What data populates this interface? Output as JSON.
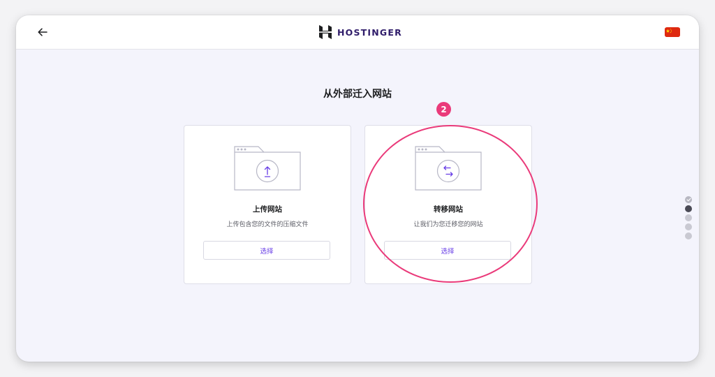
{
  "header": {
    "brand_name": "HOSTINGER",
    "brand_color": "#2f1c6a",
    "back_icon": "arrow-left-icon",
    "language_flag": "china-flag-icon"
  },
  "main": {
    "title": "从外部迁入网站",
    "cards": [
      {
        "title": "上传网站",
        "description": "上传包含您的文件的压缩文件",
        "button_label": "选择",
        "icon": "upload-icon"
      },
      {
        "title": "转移网站",
        "description": "让我们为您迁移您的网站",
        "button_label": "选择",
        "icon": "transfer-icon"
      }
    ]
  },
  "annotation": {
    "step_number": "2",
    "color": "#ea3a7a"
  },
  "stepper": {
    "total": 5,
    "current": 2
  },
  "colors": {
    "accent": "#673de6",
    "background": "#f4f4fc"
  }
}
